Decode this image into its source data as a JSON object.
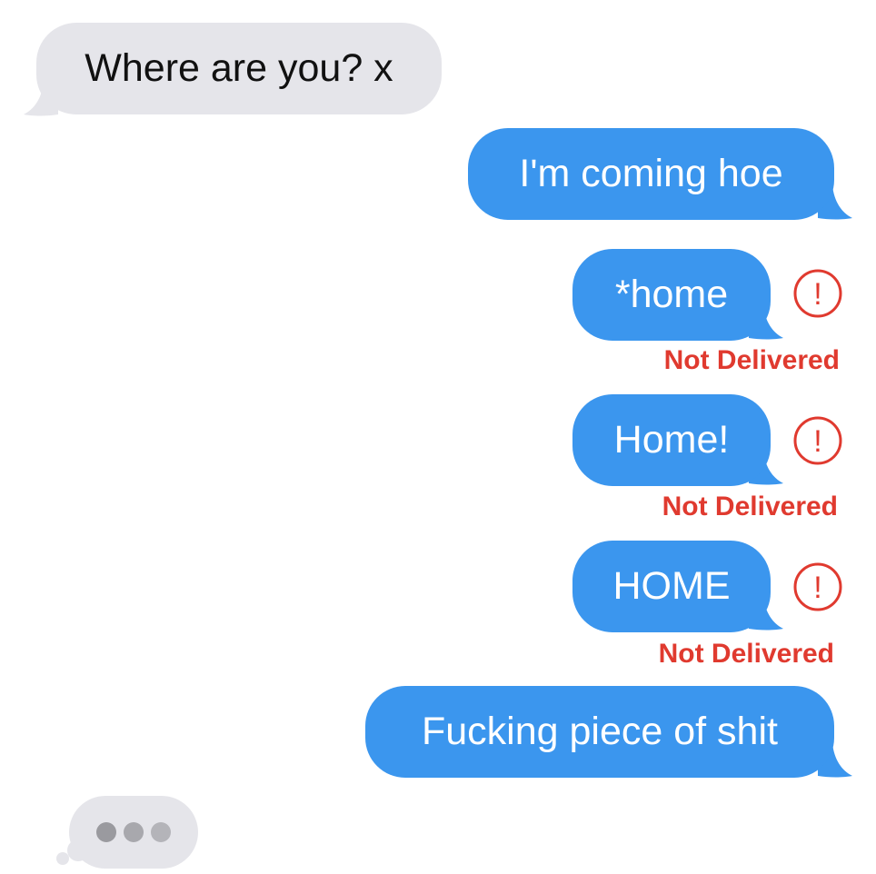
{
  "messages": [
    {
      "direction": "received",
      "text": "Where are you? x"
    },
    {
      "direction": "sent",
      "text": "I'm coming hoe"
    },
    {
      "direction": "sent",
      "text": "*home",
      "status": "Not Delivered"
    },
    {
      "direction": "sent",
      "text": "Home!",
      "status": "Not Delivered"
    },
    {
      "direction": "sent",
      "text": "HOME",
      "status": "Not Delivered"
    },
    {
      "direction": "sent",
      "text": "Fucking piece of shit"
    }
  ],
  "error_icon_glyph": "!",
  "typing_indicator": {
    "icon": "typing-dots-icon",
    "dot_count": 3
  },
  "colors": {
    "sent_bubble": "#3b96ee",
    "received_bubble": "#e5e5ea",
    "error_red": "#e03a2f"
  }
}
